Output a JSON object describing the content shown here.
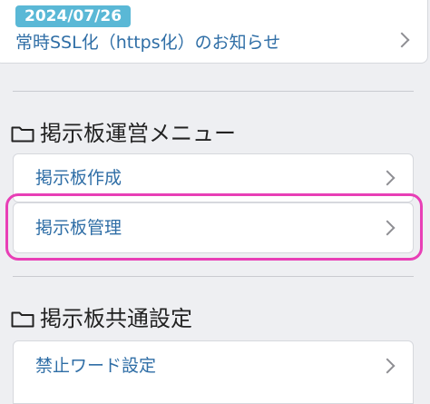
{
  "news": {
    "date": "2024/07/26",
    "title": "常時SSL化（https化）のお知らせ"
  },
  "sections": [
    {
      "title": "掲示板運営メニュー",
      "items": [
        {
          "label": "掲示板作成"
        },
        {
          "label": "掲示板管理"
        }
      ]
    },
    {
      "title": "掲示板共通設定",
      "items": [
        {
          "label": "禁止ワード設定"
        }
      ]
    }
  ],
  "colors": {
    "accent_text": "#2f6ea6",
    "badge": "#5ab8d6",
    "highlight": "#e83fb6"
  },
  "icons": [
    "folder-icon",
    "chevron-right-icon"
  ]
}
